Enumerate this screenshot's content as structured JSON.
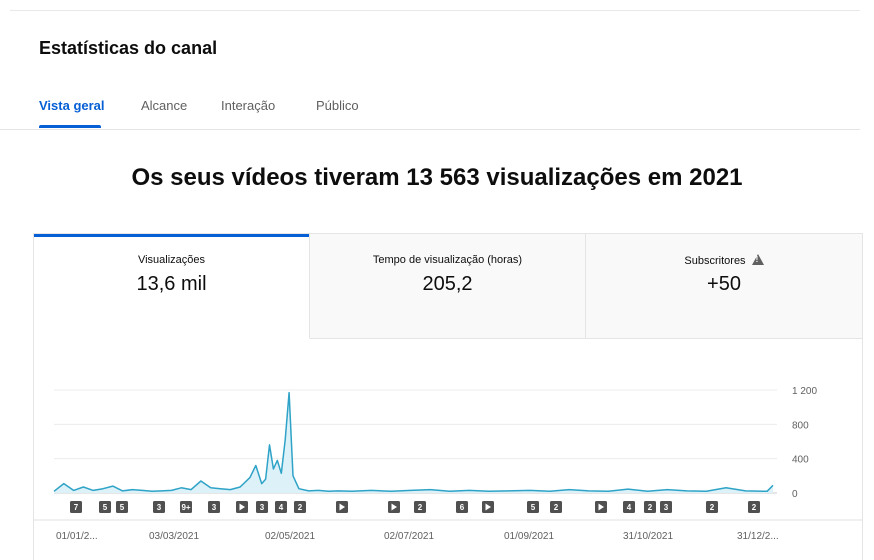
{
  "page": {
    "title": "Estatísticas do canal"
  },
  "tabs": [
    {
      "label": "Vista geral",
      "active": true
    },
    {
      "label": "Alcance",
      "active": false
    },
    {
      "label": "Interação",
      "active": false
    },
    {
      "label": "Público",
      "active": false
    }
  ],
  "headline": "Os seus vídeos tiveram 13 563 visualizações em 2021",
  "metrics": [
    {
      "label": "Visualizações",
      "value": "13,6 mil",
      "active": true
    },
    {
      "label": "Tempo de visualização (horas)",
      "value": "205,2",
      "active": false
    },
    {
      "label": "Subscritores",
      "value": "+50",
      "active": false,
      "icon": "warning-icon"
    }
  ],
  "colors": {
    "accent": "#065fd4",
    "line": "#2ea3c7",
    "fill": "#dcf1f8",
    "marker": "#505050"
  },
  "markers": [
    "7",
    "5",
    "5",
    "3",
    "9+",
    "3",
    "play",
    "3",
    "4",
    "2",
    "play",
    "play",
    "2",
    "6",
    "play",
    "5",
    "2",
    "play",
    "4",
    "2",
    "3",
    "2",
    "2"
  ],
  "chart_data": {
    "type": "area",
    "x_tick_labels": [
      "01/01/2...",
      "03/03/2021",
      "02/05/2021",
      "02/07/2021",
      "01/09/2021",
      "31/10/2021",
      "31/12/2..."
    ],
    "y_ticks": [
      0,
      400,
      800,
      1200
    ],
    "y_tick_labels": [
      "0",
      "400",
      "800",
      "1 200"
    ],
    "ylim": [
      0,
      1200
    ],
    "grid": true,
    "series": [
      {
        "x": [
          "2021-01-01",
          "2021-01-06",
          "2021-01-11",
          "2021-01-16",
          "2021-01-21",
          "2021-01-26",
          "2021-01-31",
          "2021-02-05",
          "2021-02-10",
          "2021-02-15",
          "2021-02-20",
          "2021-02-25",
          "2021-03-02",
          "2021-03-07",
          "2021-03-12",
          "2021-03-17",
          "2021-03-22",
          "2021-03-27",
          "2021-04-01",
          "2021-04-06",
          "2021-04-11",
          "2021-04-14",
          "2021-04-17",
          "2021-04-19",
          "2021-04-21",
          "2021-04-23",
          "2021-04-25",
          "2021-04-27",
          "2021-04-29",
          "2021-05-01",
          "2021-05-03",
          "2021-05-06",
          "2021-05-11",
          "2021-05-16",
          "2021-05-21",
          "2021-05-26",
          "2021-06-02",
          "2021-06-12",
          "2021-06-22",
          "2021-07-02",
          "2021-07-12",
          "2021-07-22",
          "2021-08-01",
          "2021-08-11",
          "2021-08-21",
          "2021-09-01",
          "2021-09-11",
          "2021-09-21",
          "2021-10-01",
          "2021-10-11",
          "2021-10-21",
          "2021-10-31",
          "2021-11-10",
          "2021-11-20",
          "2021-11-30",
          "2021-12-10",
          "2021-12-20",
          "2021-12-31",
          "2022-01-03"
        ],
        "values": [
          20,
          110,
          30,
          70,
          30,
          50,
          80,
          25,
          40,
          30,
          20,
          25,
          30,
          60,
          40,
          140,
          60,
          50,
          40,
          70,
          180,
          320,
          110,
          160,
          560,
          280,
          380,
          230,
          620,
          1170,
          200,
          50,
          25,
          30,
          20,
          25,
          20,
          30,
          20,
          30,
          40,
          20,
          30,
          20,
          25,
          30,
          20,
          40,
          25,
          20,
          45,
          20,
          40,
          25,
          20,
          60,
          25,
          20,
          90
        ]
      }
    ]
  }
}
